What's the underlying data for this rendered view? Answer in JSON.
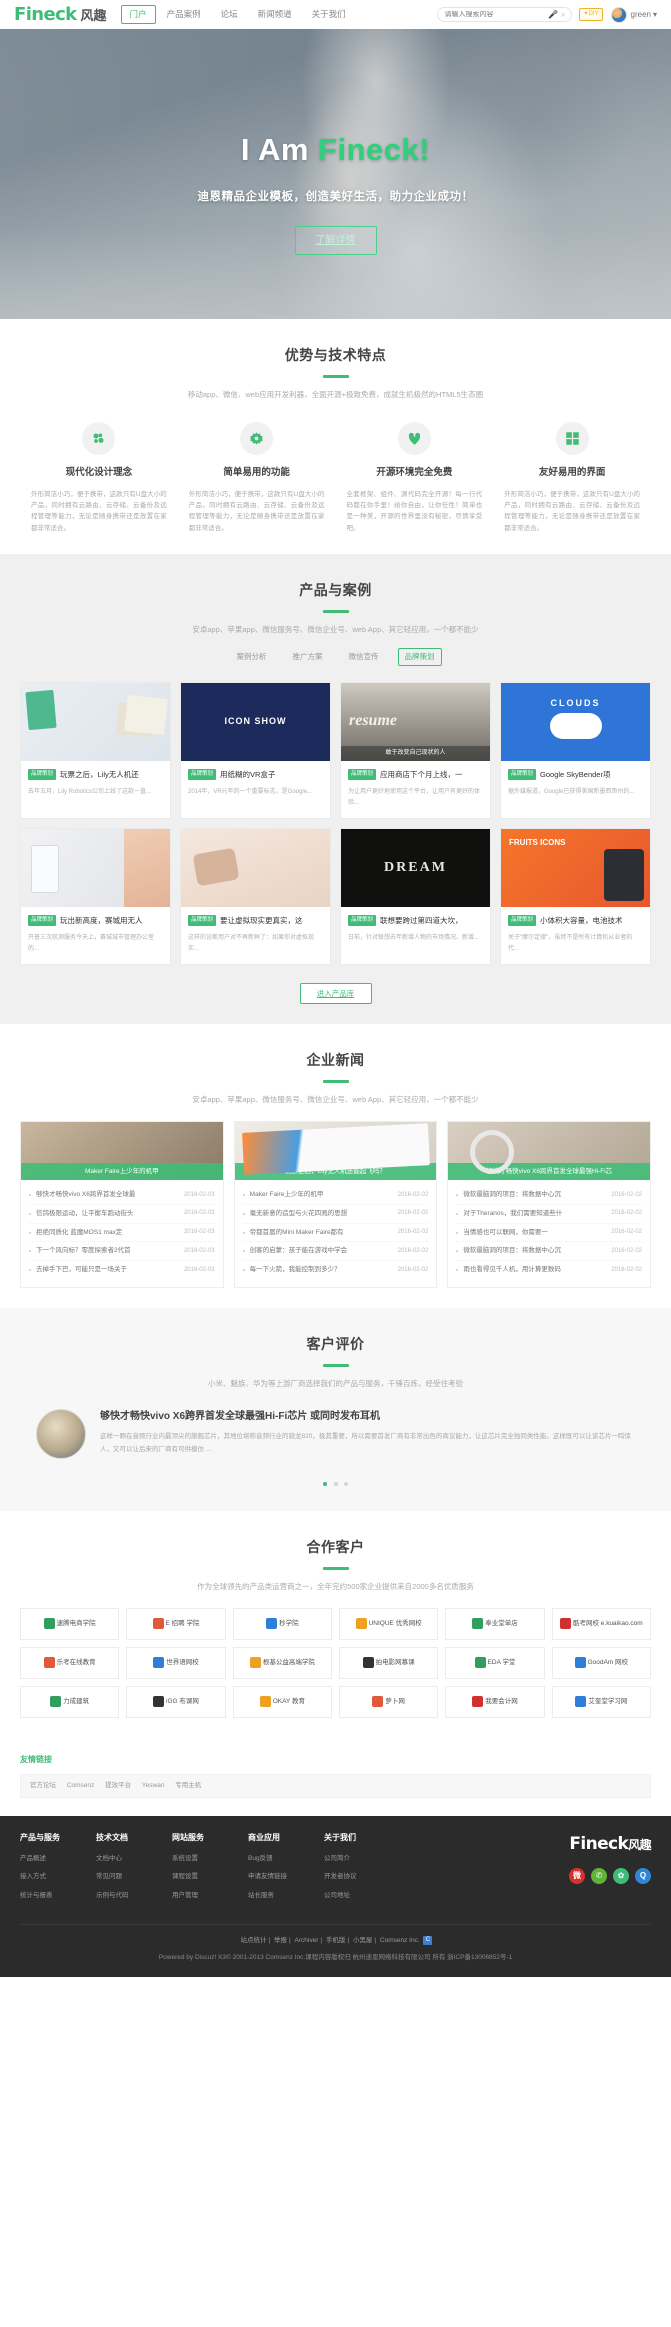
{
  "header": {
    "logo_en": "Fineck",
    "logo_cn": "风趣",
    "nav": [
      {
        "label": "门户",
        "active": true
      },
      {
        "label": "产品案例",
        "active": false
      },
      {
        "label": "论坛",
        "active": false
      },
      {
        "label": "新闻频道",
        "active": false
      },
      {
        "label": "关于我们",
        "active": false
      }
    ],
    "search_placeholder": "请输入搜索内容",
    "search_value": "",
    "mic_icon": "microphone-icon",
    "search_icon": "search-icon",
    "diy_label": "✦DIY",
    "username": "green",
    "caret": "▾"
  },
  "hero": {
    "title_plain": "I Am ",
    "title_accent": "Fineck!",
    "subtitle": "迪恩精品企业模板，创造美好生活，助力企业成功！",
    "cta": "了解详情"
  },
  "advantages": {
    "title": "优势与技术特点",
    "subtitle": "移动app、微信、web应用开发利器，全面开源+极致免费，成就生机极然的HTML5生态圈",
    "items": [
      {
        "icon": "clover-icon",
        "title": "现代化设计理念",
        "desc": "外形简洁小巧，便于携带，这款只有U盘大小的产品，同时拥有云路由、云存储、云备份及远程管理等能力，无论是随身携带还是放置在家都非常适合。"
      },
      {
        "icon": "gear-icon",
        "title": "简单易用的功能",
        "desc": "外形简洁小巧，便于携带，这款只有U盘大小的产品，同时拥有云路由、云存储、云备份及远程管理等能力，无论是随身携带还是放置在家都非常适合。"
      },
      {
        "icon": "heart-icon",
        "title": "开源环境完全免费",
        "desc": "全套框架、组件、源代码完全开源！每一行代码都在你手里！给你自由，让你任性！简单也是一种美，开源的世界里没有秘密，尽情享受吧。"
      },
      {
        "icon": "grid-icon",
        "title": "友好易用的界面",
        "desc": "外形简洁小巧，便于携带，这款只有U盘大小的产品，同时拥有云路由、云存储、云备份及远程管理等能力，无论是随身携带还是放置在家都非常适合。"
      }
    ]
  },
  "products": {
    "title": "产品与案例",
    "subtitle": "安卓app、苹果app、微信服务号、微信企业号、web App、其它轻应用，一个都不能少",
    "tabs": [
      {
        "label": "案例分析",
        "active": false
      },
      {
        "label": "推广方案",
        "active": false
      },
      {
        "label": "微信宣传",
        "active": false
      },
      {
        "label": "品牌策划",
        "active": true
      }
    ],
    "tag": "品牌策划",
    "cards": [
      {
        "thumb": "t1",
        "thumb_text": "",
        "title": "玩票之后，Lily无人机还",
        "desc": "去年五月，Lily Robotics公司上线了这款一直..."
      },
      {
        "thumb": "t2",
        "thumb_text": "ICON SHOW",
        "title": "用纸糊的VR盒子",
        "desc": "2014年，VR元年的一个重要标志，是Google..."
      },
      {
        "thumb": "t3",
        "thumb_text": "敢于改变自己现状的人",
        "title": "应用商店下个月上线，一",
        "desc": "为让用户更好地使用这个平台，让用户有更好的体验..."
      },
      {
        "thumb": "t4",
        "thumb_text": "CLOUDS",
        "title": "Google SkyBender项",
        "desc": "据外媒报道，Google已获得美国新墨西哥州的..."
      },
      {
        "thumb": "t5",
        "thumb_text": "",
        "title": "玩出新高度，赛城用无人",
        "desc": "开普三次航测服务今天上，赛城城市管理办公室的..."
      },
      {
        "thumb": "t6",
        "thumb_text": "",
        "title": "要让虚拟现实更真实，这",
        "desc": "这样的论断用户对不再新鲜了：如果你对虚拟现实..."
      },
      {
        "thumb": "t7",
        "thumb_text": "DREAM",
        "title": "联想要跨过第四道大坎，",
        "desc": "日前，针对联想去年新增人物的市场情况、新增..."
      },
      {
        "thumb": "t8",
        "thumb_text": "FRUITS ICONS",
        "title": "小体积大容量，电池技术",
        "desc": "关于\"摩尔定律\"，虽然不是所有计算机从业者的代..."
      }
    ],
    "enter_label": "进入产品库"
  },
  "news": {
    "title": "企业新闻",
    "subtitle": "安卓app、苹果app、微信服务号、微信企业号、web App、其它轻应用，一个都不能少",
    "cards": [
      {
        "thumb": "n1",
        "caption": "Maker Faire上少年的机甲",
        "items": [
          {
            "text": "够快才畅快vivo X6跨界首发全球最",
            "date": "2016-02-03"
          },
          {
            "text": "信鸽极限运动，让平衡车跑动街头",
            "date": "2016-02-03"
          },
          {
            "text": "拒绝同质化 蓝魔MOS1 max定",
            "date": "2016-02-03"
          },
          {
            "text": "下一个风向标？零度探索者2代首",
            "date": "2016-02-03"
          },
          {
            "text": "去掉手下巴，可能只是一场关于",
            "date": "2016-02-03"
          }
        ]
      },
      {
        "thumb": "n2",
        "caption": "跳票之后，Lily无人机还能起飞吗？",
        "items": [
          {
            "text": "Maker Faire上少年的机甲",
            "date": "2016-02-02"
          },
          {
            "text": "毫无新意的造型与火花四溅的思想",
            "date": "2016-02-02"
          },
          {
            "text": "帝都首届的Mini Maker Faire都有",
            "date": "2016-02-02"
          },
          {
            "text": "创客的启蒙：孩子能在游戏中学会",
            "date": "2016-02-02"
          },
          {
            "text": "每一下火箭，我能控制到多少？",
            "date": "2016-02-02"
          }
        ]
      },
      {
        "thumb": "n3",
        "caption": "够快才畅快vivo X6跨界首发全球最强Hi-Fi芯",
        "items": [
          {
            "text": "微软最脑洞的项目：将数据中心沉",
            "date": "2016-02-02"
          },
          {
            "text": "对于Theranos，我们需要知道些什",
            "date": "2016-02-02"
          },
          {
            "text": "当情感也可以联网，你需要一",
            "date": "2016-02-02"
          },
          {
            "text": "微软最脑洞的项目：将数据中心沉",
            "date": "2016-02-02"
          },
          {
            "text": "雨也看得见千人机，用计算更数码",
            "date": "2016-02-02"
          }
        ]
      }
    ]
  },
  "testimonials": {
    "title": "客户评价",
    "subtitle": "小米、魅族、华为等上游厂商选择我们的产品与服务，千锤百炼，经受住考验",
    "item": {
      "title": "够快才畅快vivo X6跨界首发全球最强Hi-Fi芯片 或同时发布耳机",
      "desc": "这样一颗在音频行业内最顶尖的旗舰芯片，其地位堪称音频行业的骁龙820，极其重要，所以需要首发厂商有非常出色的商议能力，让这芯片完全独同类性能。这样既可以让该芯片一鸣惊人，又可以让后来的厂商有可供模仿 …"
    },
    "dots": [
      true,
      false,
      false
    ]
  },
  "clients": {
    "title": "合作客户",
    "subtitle": "作为全球领先的产品类运营商之一，全年完约500家企业提供来自2000多名优质服务",
    "cells": [
      {
        "label": "速腾电商学院",
        "color": "#2f9e5e"
      },
      {
        "label": "E 招聘 学院",
        "color": "#e05a3a"
      },
      {
        "label": "秒学院",
        "color": "#2f7ed8"
      },
      {
        "label": "UNIQUE 优秀网校",
        "color": "#f0a020"
      },
      {
        "label": "奉业堂单店",
        "color": "#2f9e5e"
      },
      {
        "label": "酷考网校 e.kuaikao.com",
        "color": "#d03030"
      },
      {
        "label": "乐考在线教育",
        "color": "#e05a3a"
      },
      {
        "label": "世界语网校",
        "color": "#2f7ed8"
      },
      {
        "label": "根基公益高端学院",
        "color": "#f0a020"
      },
      {
        "label": "拍电影网慕课",
        "color": "#333333"
      },
      {
        "label": "EDA 学堂",
        "color": "#2f9e5e"
      },
      {
        "label": "GoodAm 网校",
        "color": "#2f7ed8"
      },
      {
        "label": "力成建筑",
        "color": "#2f9e5e"
      },
      {
        "label": "iGG 布课网",
        "color": "#333333"
      },
      {
        "label": "OKAY 教育",
        "color": "#f0a020"
      },
      {
        "label": "萝卜网",
        "color": "#e05a3a"
      },
      {
        "label": "我要会计网",
        "color": "#d03030"
      },
      {
        "label": "艾奎堂学习网",
        "color": "#2f7ed8"
      }
    ]
  },
  "friendly_links": {
    "title": "友情链接",
    "items": [
      "官方论坛",
      "Comsenz",
      "提效平台",
      "Yeswan",
      "专用主机"
    ]
  },
  "footer": {
    "columns": [
      {
        "heading": "产品与服务",
        "links": [
          "产品概述",
          "接入方式",
          "统计与报表"
        ]
      },
      {
        "heading": "技术文档",
        "links": [
          "文档中心",
          "常见问题",
          "示例与代码"
        ]
      },
      {
        "heading": "网站服务",
        "links": [
          "系统设置",
          "课程设置",
          "用户管理"
        ]
      },
      {
        "heading": "商业应用",
        "links": [
          "Bug反馈",
          "申请友情链接",
          "站长服务"
        ]
      },
      {
        "heading": "关于我们",
        "links": [
          "公司简介",
          "开发者协议",
          "公司地址"
        ]
      }
    ],
    "logo_en": "Fineck",
    "logo_cn": "风趣",
    "socials": [
      {
        "name": "weibo-icon",
        "glyph": "微",
        "color": "#d5322f"
      },
      {
        "name": "wechat-icon",
        "glyph": "✆",
        "color": "#5fb336"
      },
      {
        "name": "qzone-icon",
        "glyph": "✿",
        "color": "#3fbd78"
      },
      {
        "name": "qq-icon",
        "glyph": "Q",
        "color": "#2f86d8"
      }
    ],
    "bottom_links": [
      "站点统计",
      "举报",
      "Archiver",
      "手机版",
      "小黑屋",
      "Comsenz Inc."
    ],
    "badge": "C",
    "powered": "Powered by Discuz! X3© 2001-2013 Comsenz Inc.课程内容版权归 杭州迪恩网络科技有限公司 所有 浙ICP备13006852号-1"
  }
}
